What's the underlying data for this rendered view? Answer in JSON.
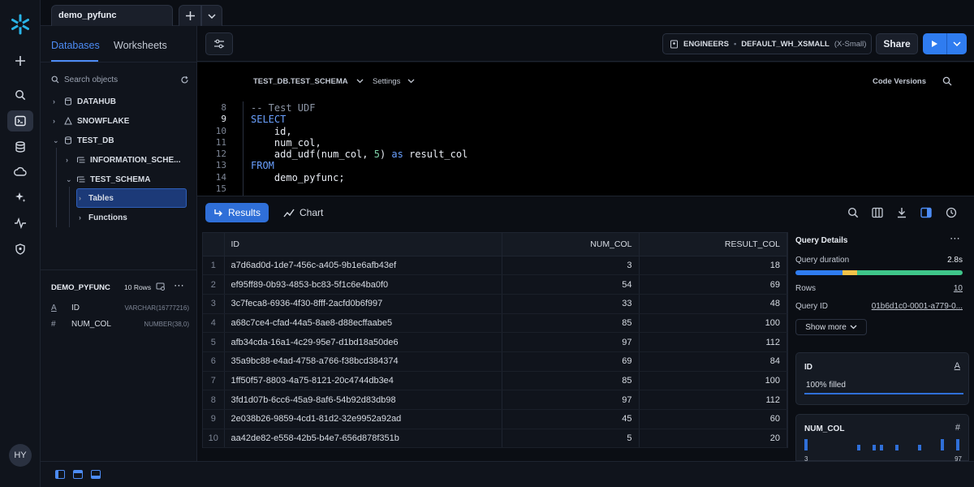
{
  "app": {
    "tab_title": "demo_pyfunc",
    "user_initials": "HY",
    "rail_icons": [
      "plus-icon",
      "search-icon",
      "worksheets-icon",
      "database-icon",
      "cloud-icon",
      "sparkle-icon",
      "activity-icon",
      "shield-icon"
    ]
  },
  "left_panel": {
    "tabs": [
      "Databases",
      "Worksheets"
    ],
    "active_tab": "Databases",
    "search_placeholder": "Search objects",
    "tree": [
      {
        "label": "DATAHUB",
        "level": 0
      },
      {
        "label": "SNOWFLAKE",
        "level": 0
      },
      {
        "label": "TEST_DB",
        "level": 0
      },
      {
        "label": "INFORMATION_SCHE...",
        "level": 1
      },
      {
        "label": "TEST_SCHEMA",
        "level": 1
      },
      {
        "label": "Tables",
        "level": 2,
        "selected": true
      },
      {
        "label": "Functions",
        "level": 2
      }
    ],
    "object": {
      "name": "DEMO_PYFUNC",
      "rows": "10 Rows",
      "columns": [
        {
          "type_glyph": "A",
          "name": "ID",
          "type": "VARCHAR(16777216)"
        },
        {
          "type_glyph": "#",
          "name": "NUM_COL",
          "type": "NUMBER(38,0)"
        }
      ]
    }
  },
  "toolbar": {
    "role": "ENGINEERS",
    "warehouse": "DEFAULT_WH_XSMALL",
    "warehouse_size": "(X-Small)",
    "share_label": "Share"
  },
  "editor": {
    "context": "TEST_DB.TEST_SCHEMA",
    "settings_label": "Settings",
    "code_versions_label": "Code Versions",
    "lines": [
      {
        "n": "8",
        "text": "-- Test UDF"
      },
      {
        "n": "9",
        "text": "SELECT"
      },
      {
        "n": "10",
        "text": "    id,"
      },
      {
        "n": "11",
        "text": "    num_col,"
      },
      {
        "n": "12",
        "text": "    add_udf(num_col, 5) as result_col"
      },
      {
        "n": "13",
        "text": "FROM"
      },
      {
        "n": "14",
        "text": "    demo_pyfunc;"
      },
      {
        "n": "15",
        "text": ""
      }
    ]
  },
  "results": {
    "tab_results": "Results",
    "tab_chart": "Chart",
    "columns": [
      "ID",
      "NUM_COL",
      "RESULT_COL"
    ],
    "rows": [
      [
        "1",
        "a7d6ad0d-1de7-456c-a405-9b1e6afb43ef",
        "3",
        "18"
      ],
      [
        "2",
        "ef95ff89-0b93-4853-bc83-5f1c6e4ba0f0",
        "54",
        "69"
      ],
      [
        "3",
        "3c7feca8-6936-4f30-8fff-2acfd0b6f997",
        "33",
        "48"
      ],
      [
        "4",
        "a68c7ce4-cfad-44a5-8ae8-d88ecffaabe5",
        "85",
        "100"
      ],
      [
        "5",
        "afb34cda-16a1-4c29-95e7-d1bd18a50de6",
        "97",
        "112"
      ],
      [
        "6",
        "35a9bc88-e4ad-4758-a766-f38bcd384374",
        "69",
        "84"
      ],
      [
        "7",
        "1ff50f57-8803-4a75-8121-20c4744db3e4",
        "85",
        "100"
      ],
      [
        "8",
        "3fd1d07b-6cc6-45a9-8af6-54b92d83db98",
        "97",
        "112"
      ],
      [
        "9",
        "2e038b26-9859-4cd1-81d2-32e9952a92ad",
        "45",
        "60"
      ],
      [
        "10",
        "aa42de82-e558-42b5-b4e7-656d878f351b",
        "5",
        "20"
      ]
    ]
  },
  "details": {
    "title": "Query Details",
    "duration_label": "Query duration",
    "duration_value": "2.8s",
    "rows_label": "Rows",
    "rows_value": "10",
    "query_id_label": "Query ID",
    "query_id_value": "01b6d1c0-0001-a779-0...",
    "show_more": "Show more",
    "duration_segments": [
      {
        "fraction": 0.28,
        "color": "#2f7cf0"
      },
      {
        "fraction": 0.09,
        "color": "#f0c24a"
      },
      {
        "fraction": 0.63,
        "color": "#3fc58a"
      }
    ],
    "id_card": {
      "title": "ID",
      "type_glyph": "A",
      "fill_text": "100% filled"
    },
    "num_card": {
      "title": "NUM_COL",
      "type_glyph": "#",
      "min": "3",
      "max": "97",
      "histogram": [
        0.8,
        0,
        0,
        0,
        0,
        0,
        0,
        0.4,
        0,
        0.4,
        0.4,
        0,
        0.4,
        0,
        0,
        0.4,
        0,
        0,
        0.8,
        0,
        0.8
      ]
    }
  }
}
